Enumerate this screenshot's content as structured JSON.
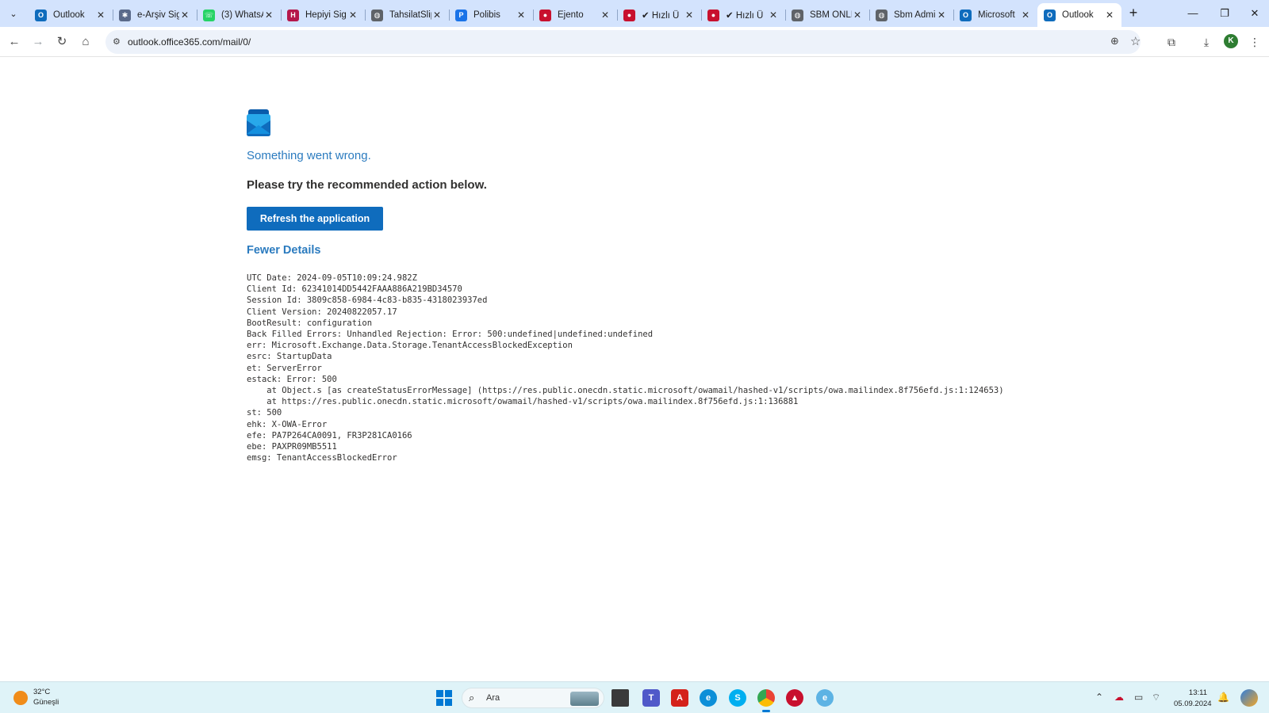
{
  "browser": {
    "tabs": [
      {
        "label": "Outlook",
        "icon": "outlook-icon",
        "color": "#0f6cbd",
        "glyph": "O"
      },
      {
        "label": "e-Arşiv Sig",
        "icon": "snowflake-icon",
        "color": "#5a6a8a",
        "glyph": "✱"
      },
      {
        "label": "(3) WhatsA",
        "icon": "whatsapp-icon",
        "color": "#25d366",
        "glyph": "☏"
      },
      {
        "label": "Hepiyi Sig",
        "icon": "hepiyi-icon",
        "color": "#b5174b",
        "glyph": "H"
      },
      {
        "label": "TahsilatSlip",
        "icon": "globe-icon",
        "color": "#5f6368",
        "glyph": "◍"
      },
      {
        "label": "Polibis",
        "icon": "polibis-icon",
        "color": "#1a73e8",
        "glyph": "P"
      },
      {
        "label": "Ejento",
        "icon": "ejento-icon",
        "color": "#c8102e",
        "glyph": "●"
      },
      {
        "label": "✔ Hızlı Ü",
        "icon": "ejento-icon",
        "color": "#c8102e",
        "glyph": "●"
      },
      {
        "label": "✔ Hızlı Ü",
        "icon": "ejento-icon",
        "color": "#c8102e",
        "glyph": "●"
      },
      {
        "label": "SBM ONLI",
        "icon": "globe-icon",
        "color": "#5f6368",
        "glyph": "◍"
      },
      {
        "label": "Sbm Admi",
        "icon": "globe-icon",
        "color": "#5f6368",
        "glyph": "◍"
      },
      {
        "label": "Microsoft",
        "icon": "microsoft-outlook-icon",
        "color": "#0f6cbd",
        "glyph": "O"
      },
      {
        "label": "Outlook",
        "icon": "outlook-icon",
        "color": "#0f6cbd",
        "glyph": "O",
        "active": true
      }
    ],
    "url": "outlook.office365.com/mail/0/",
    "profile_initial": "K"
  },
  "error_page": {
    "heading": "Something went wrong.",
    "instruction": "Please try the recommended action below.",
    "refresh_button": "Refresh the application",
    "toggle_details": "Fewer Details",
    "details": [
      "UTC Date: 2024-09-05T10:09:24.982Z",
      "Client Id: 62341014DD5442FAAA886A219BD34570",
      "Session Id: 3809c858-6984-4c83-b835-4318023937ed",
      "Client Version: 20240822057.17",
      "BootResult: configuration",
      "Back Filled Errors: Unhandled Rejection: Error: 500:undefined|undefined:undefined",
      "err: Microsoft.Exchange.Data.Storage.TenantAccessBlockedException",
      "esrc: StartupData",
      "et: ServerError",
      "estack: Error: 500",
      "    at Object.s [as createStatusErrorMessage] (https://res.public.onecdn.static.microsoft/owamail/hashed-v1/scripts/owa.mailindex.8f756efd.js:1:124653)",
      "    at https://res.public.onecdn.static.microsoft/owamail/hashed-v1/scripts/owa.mailindex.8f756efd.js:1:136881",
      "st: 500",
      "ehk: X-OWA-Error",
      "efe: PA7P264CA0091, FR3P281CA0166",
      "ebe: PAXPR09MB5511",
      "emsg: TenantAccessBlockedError"
    ]
  },
  "taskbar": {
    "weather_temp": "32°C",
    "weather_desc": "Güneşli",
    "search_placeholder": "Ara",
    "time": "13:11",
    "date": "05.09.2024"
  }
}
